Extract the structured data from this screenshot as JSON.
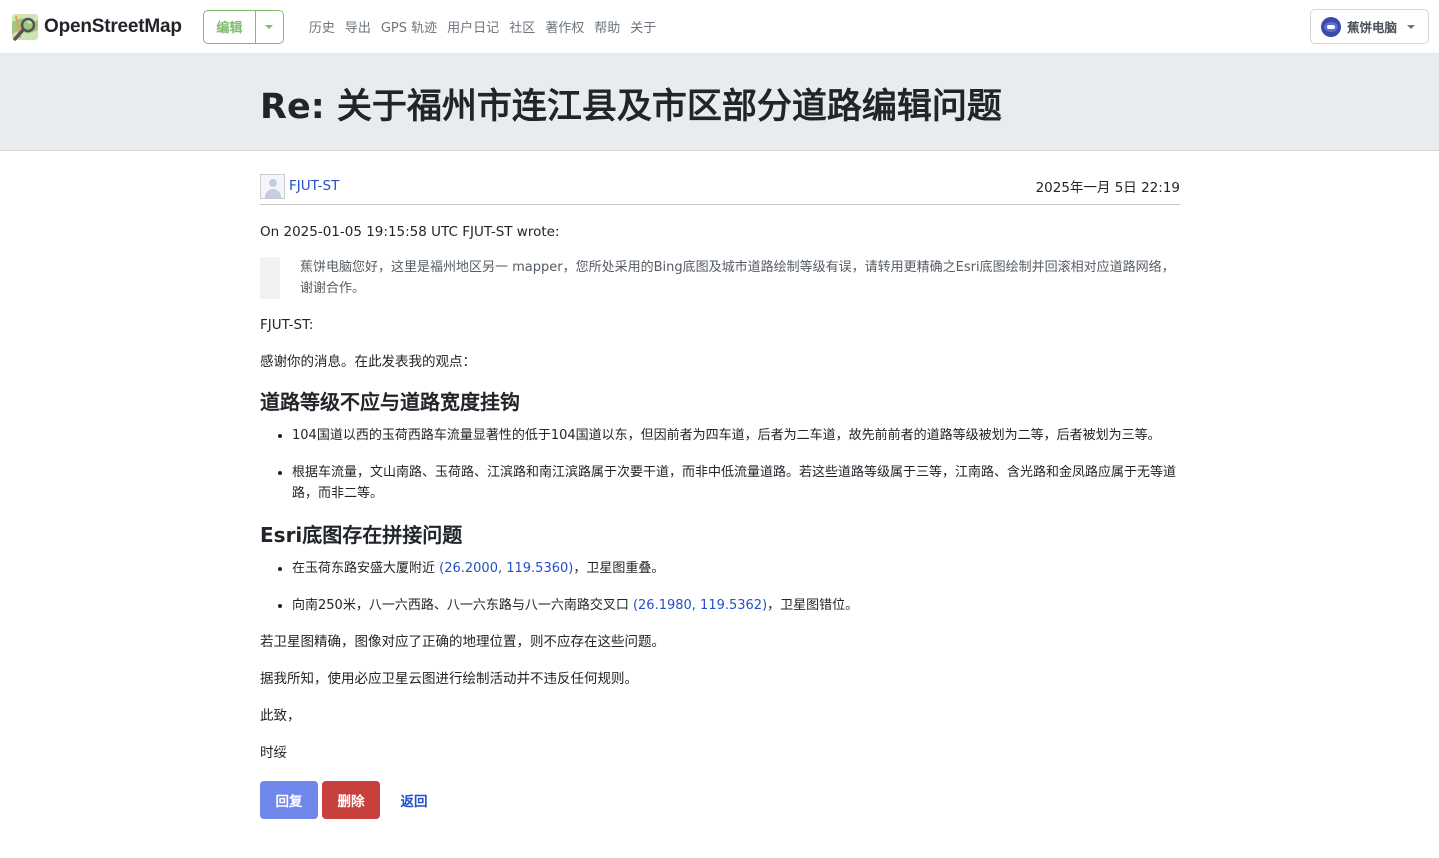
{
  "brand": {
    "name": "OpenStreetMap"
  },
  "header": {
    "edit_label": "编辑",
    "nav": [
      "历史",
      "导出",
      "GPS 轨迹",
      "用户日记",
      "社区",
      "著作权",
      "帮助",
      "关于"
    ],
    "user_name": "蕉饼电脑"
  },
  "page": {
    "title": "Re: 关于福州市连江县及市区部分道路编辑问题"
  },
  "message": {
    "author": "FJUT-ST",
    "date": "2025年一月 5日 22:19",
    "wrote_line": "On 2025-01-05 19:15:58 UTC FJUT-ST wrote:",
    "quote": "蕉饼电脑您好，这里是福州地区另一 mapper，您所处采用的Bing底图及城市道路绘制等级有误，请转用更精确之Esri底图绘制并回滚相对应道路网络，谢谢合作。",
    "signature_author": "FJUT-ST:",
    "intro": "感谢你的消息。在此发表我的观点：",
    "section1_title": "道路等级不应与道路宽度挂钩",
    "section1_items": [
      "104国道以西的玉荷西路车流量显著性的低于104国道以东，但因前者为四车道，后者为二车道，故先前前者的道路等级被划为二等，后者被划为三等。",
      "根据车流量，文山南路、玉荷路、江滨路和南江滨路属于次要干道，而非中低流量道路。若这些道路等级属于三等，江南路、含光路和金凤路应属于无等道路，而非二等。"
    ],
    "section2_title": "Esri底图存在拼接问题",
    "section2_items": [
      {
        "before": "在玉荷东路安盛大厦附近 ",
        "link": "(26.2000, 119.5360)",
        "after": "，卫星图重叠。"
      },
      {
        "before": "向南250米，八一六西路、八一六东路与八一六南路交叉口 ",
        "link": "(26.1980, 119.5362)",
        "after": "，卫星图错位。"
      }
    ],
    "para1": "若卫星图精确，图像对应了正确的地理位置，则不应存在这些问题。",
    "para2": "据我所知，使用必应卫星云图进行绘制活动并不违反任何规则。",
    "closing": "此致，",
    "signoff": "时绥"
  },
  "actions": {
    "reply": "回复",
    "delete": "删除",
    "back": "返回"
  },
  "colors": {
    "brand_green": "#7ebc6f",
    "link_blue": "#2150c8",
    "reply_blue": "#6f86ea",
    "delete_red": "#c8403c",
    "title_band": "#e9ecef"
  }
}
